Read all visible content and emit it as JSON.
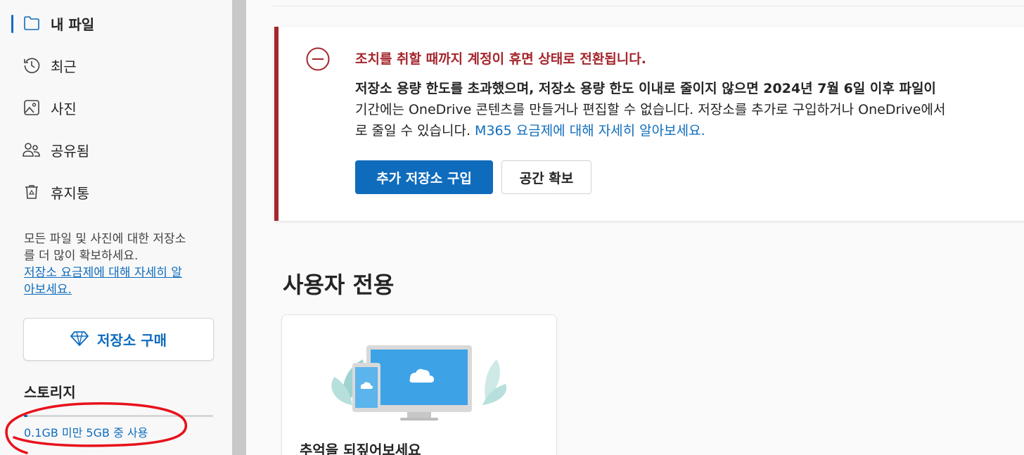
{
  "sidebar": {
    "items": [
      {
        "label": "내 파일",
        "icon": "folder-icon",
        "active": true
      },
      {
        "label": "최근",
        "icon": "history-icon"
      },
      {
        "label": "사진",
        "icon": "image-icon"
      },
      {
        "label": "공유됨",
        "icon": "people-icon"
      },
      {
        "label": "휴지통",
        "icon": "recycle-bin-icon"
      }
    ],
    "promo_line1": "모든 파일 및 사진에 대한 저장소",
    "promo_line2": "를 더 많이 확보하세요.",
    "promo_link_line1": "저장소 요금제에 대해 자세히 알",
    "promo_link_line2": "아보세요.",
    "buy_button": {
      "label": "저장소 구매",
      "icon": "diamond-icon"
    },
    "storage_title": "스토리지",
    "storage_usage_text": "0.1GB 미만 5GB 중 사용",
    "storage_used_fraction": 0.02
  },
  "alert": {
    "icon": "minus-circle-icon",
    "title": "조치를 취할 때까지 계정이 휴면 상태로 전환됩니다.",
    "line1_bold": "저장소 용량 한도를 초과했으며, 저장소 용량 한도 이내로 줄이지 않으면 2024년 7월 6일 이후 파일이 ",
    "line2": "기간에는 OneDrive 콘텐츠를 만들거나 편집할 수 없습니다. 저장소를 추가로 구입하거나 OneDrive에서",
    "line3_prefix": "로 줄일 수 있습니다. ",
    "line3_link": "M365 요금제에 대해 자세히 알아보세요.",
    "primary_button": "추가 저장소 구입",
    "secondary_button": "공간 확보"
  },
  "section_title": "사용자 전용",
  "card": {
    "title": "추억을 되짚어보세요",
    "illustration": "devices-cloud-illustration"
  },
  "colors": {
    "accent": "#0f6cbd",
    "alert_red": "#a4262c",
    "annotation_red": "#e8111b"
  }
}
